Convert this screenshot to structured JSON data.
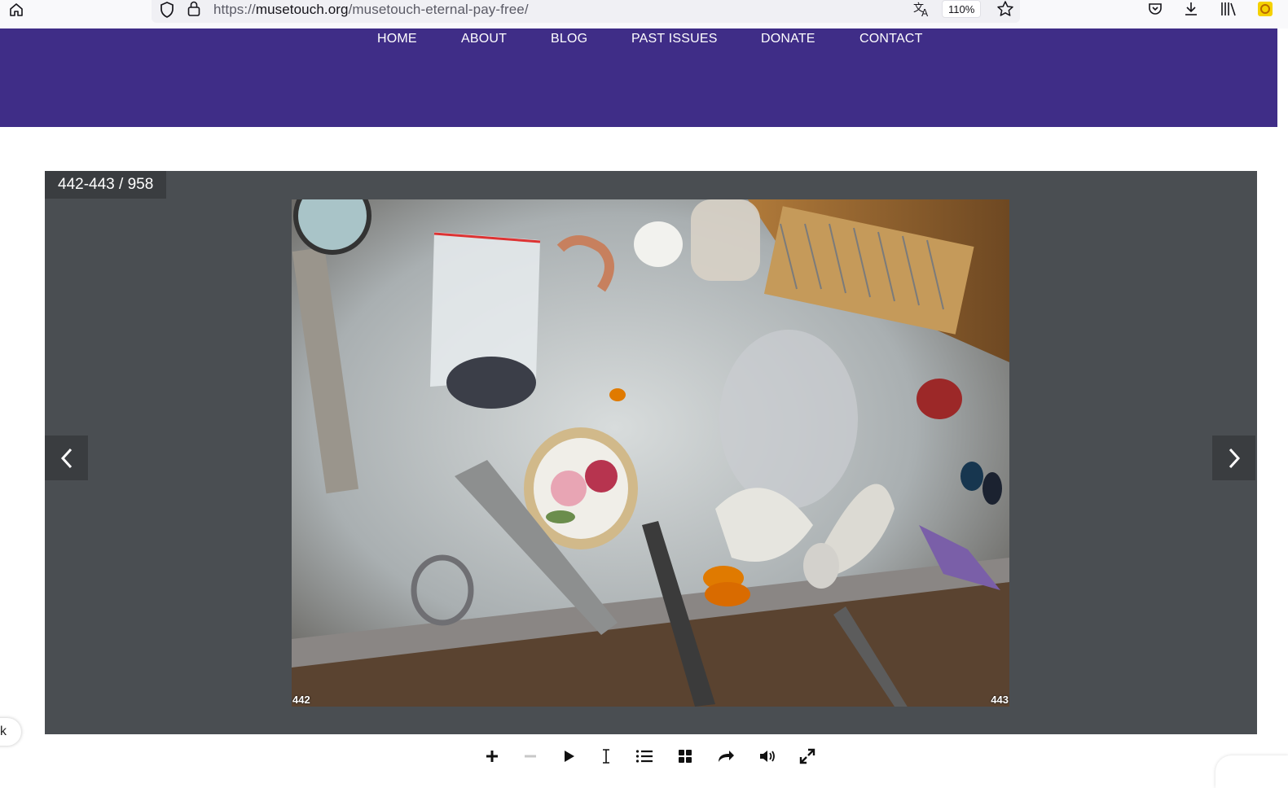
{
  "browser": {
    "url_scheme": "https://",
    "url_host": "musetouch.org",
    "url_path": "/musetouch-eternal-pay-free/",
    "zoom": "110%"
  },
  "nav": {
    "items": [
      {
        "label": "HOME"
      },
      {
        "label": "ABOUT"
      },
      {
        "label": "BLOG"
      },
      {
        "label": "PAST ISSUES"
      },
      {
        "label": "DONATE"
      },
      {
        "label": "CONTACT"
      }
    ],
    "background": "#3f2d87"
  },
  "flipbook": {
    "counter": "442-443 / 958",
    "left_page_number": "442",
    "right_page_number": "443",
    "background": "#4a4e52"
  },
  "side_tab": {
    "label": "k"
  },
  "icons": {
    "browser": [
      "home-icon",
      "shield-icon",
      "lock-icon",
      "translate-icon",
      "star-icon",
      "pocket-icon",
      "download-icon",
      "library-icon",
      "extension-icon"
    ],
    "toolbar": [
      "zoom-in-icon",
      "zoom-out-icon",
      "play-icon",
      "text-select-icon",
      "table-of-contents-icon",
      "thumbnails-icon",
      "share-icon",
      "sound-icon",
      "fullscreen-icon"
    ]
  }
}
